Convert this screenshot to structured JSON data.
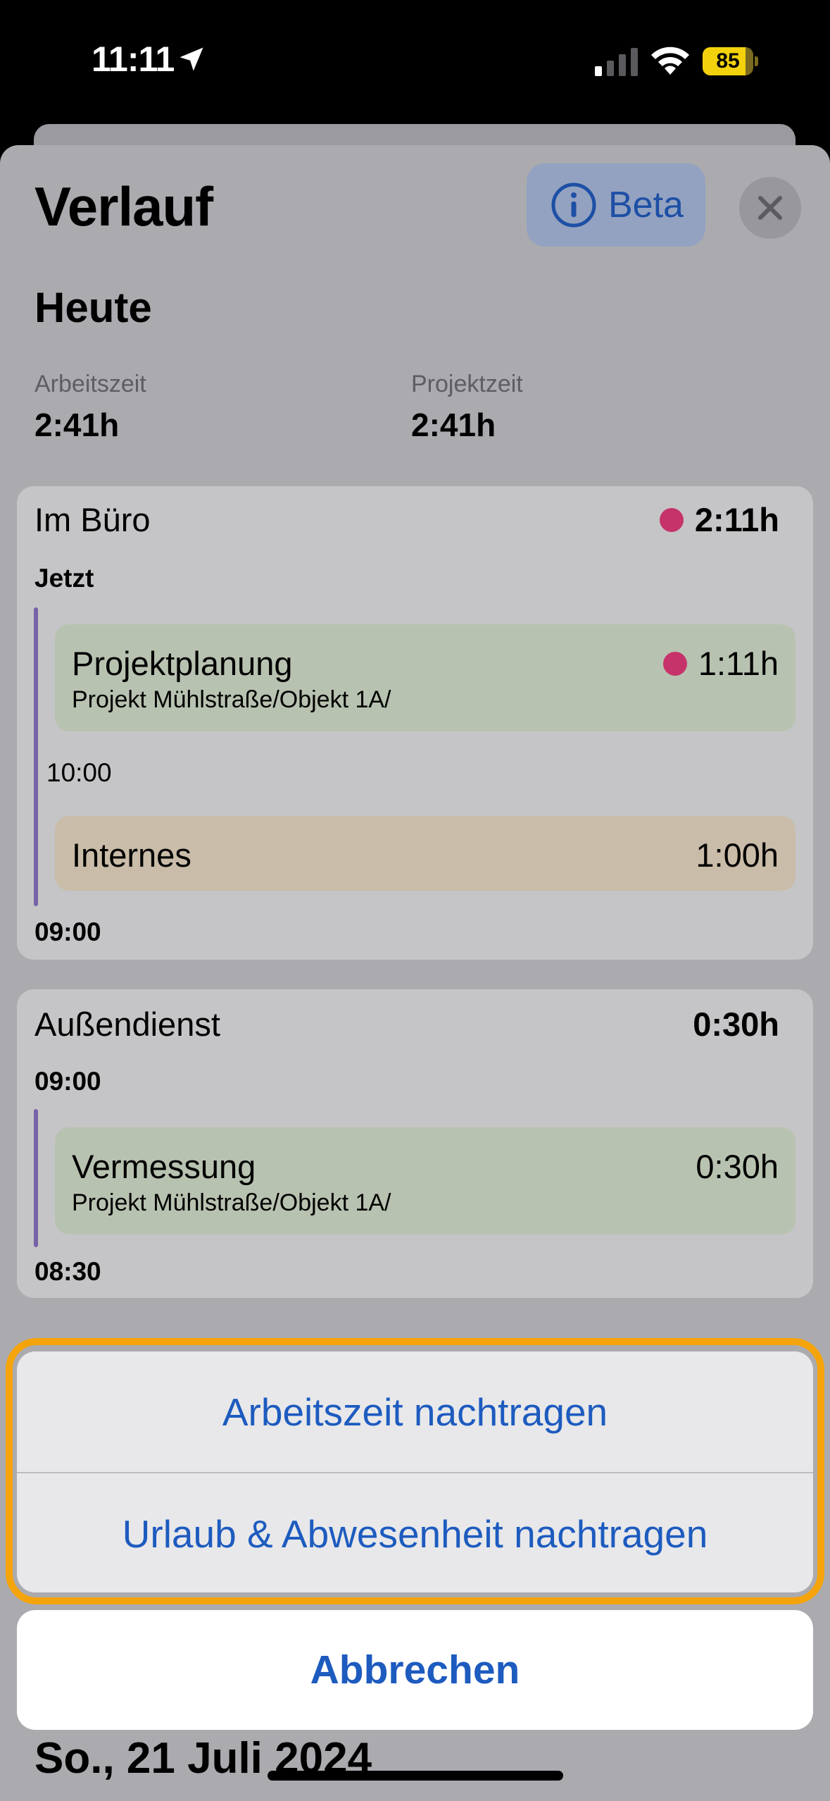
{
  "status_bar": {
    "time": "11:11",
    "battery": "85",
    "battery_level": 0.85,
    "icons": [
      "location-arrow-icon",
      "cellular-signal-icon",
      "wifi-icon",
      "battery-icon"
    ]
  },
  "header": {
    "title": "Verlauf",
    "beta_label": "Beta",
    "icons": [
      "info-icon",
      "close-icon"
    ]
  },
  "today": {
    "heading": "Heute",
    "work_time_label": "Arbeitszeit",
    "work_time_value": "2:41h",
    "project_time_label": "Projektzeit",
    "project_time_value": "2:41h"
  },
  "cards": [
    {
      "title": "Im Büro",
      "total": "2:11h",
      "start_label": "Jetzt",
      "mid_label": "10:00",
      "end_label": "09:00",
      "entries": [
        {
          "title": "Projektplanung",
          "subtitle": "Projekt Mühlstraße/Objekt 1A/",
          "time": "1:11h",
          "active": true
        },
        {
          "title": "Internes",
          "time": "1:00h",
          "active": false
        }
      ]
    },
    {
      "title": "Außendienst",
      "total": "0:30h",
      "start_label": "09:00",
      "end_label": "08:30",
      "entries": [
        {
          "title": "Vermessung",
          "subtitle": "Projekt Mühlstraße/Objekt 1A/",
          "time": "0:30h",
          "active": false
        }
      ]
    }
  ],
  "action_sheet": {
    "actions": [
      "Arbeitszeit nachtragen",
      "Urlaub & Abwesenheit nachtragen"
    ],
    "cancel": "Abbrechen"
  },
  "footer": {
    "date_heading": "So., 21 Juli 2024"
  },
  "colors": {
    "accent": "#1d5bbf",
    "active_dot": "#c6336a",
    "timeline": "#7762a8",
    "highlight": "#f5a30a"
  }
}
